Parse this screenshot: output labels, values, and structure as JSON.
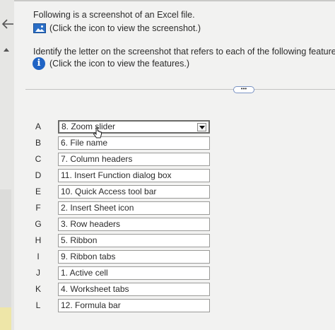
{
  "header": {
    "intro_text": "Following is a screenshot of an Excel file.",
    "screenshot_link": "(Click the icon to view the screenshot.)",
    "question_text": "Identify the letter on the screenshot that refers to each of the following features:",
    "features_link": "(Click the icon to view the features.)",
    "info_glyph": "i",
    "more_label": "•••"
  },
  "rows": [
    {
      "letter": "A",
      "answer": "8. Zoom slider"
    },
    {
      "letter": "B",
      "answer": "6. File name"
    },
    {
      "letter": "C",
      "answer": "7. Column headers"
    },
    {
      "letter": "D",
      "answer": "11. Insert Function dialog box"
    },
    {
      "letter": "E",
      "answer": "10. Quick Access tool bar"
    },
    {
      "letter": "F",
      "answer": "2. Insert Sheet icon"
    },
    {
      "letter": "G",
      "answer": "3. Row headers"
    },
    {
      "letter": "H",
      "answer": "5. Ribbon"
    },
    {
      "letter": "I",
      "answer": "9. Ribbon tabs"
    },
    {
      "letter": "J",
      "answer": "1. Active cell"
    },
    {
      "letter": "K",
      "answer": "4. Worksheet tabs"
    },
    {
      "letter": "L",
      "answer": "12. Formula bar"
    }
  ],
  "icons": {
    "back": "arrow-left-icon",
    "screenshot": "image-icon",
    "info": "info-icon",
    "dropdown": "chevron-down-icon",
    "cursor": "hand-cursor-icon"
  },
  "colors": {
    "info_blue": "#1f63c4",
    "image_blue": "#2a6ec6"
  }
}
